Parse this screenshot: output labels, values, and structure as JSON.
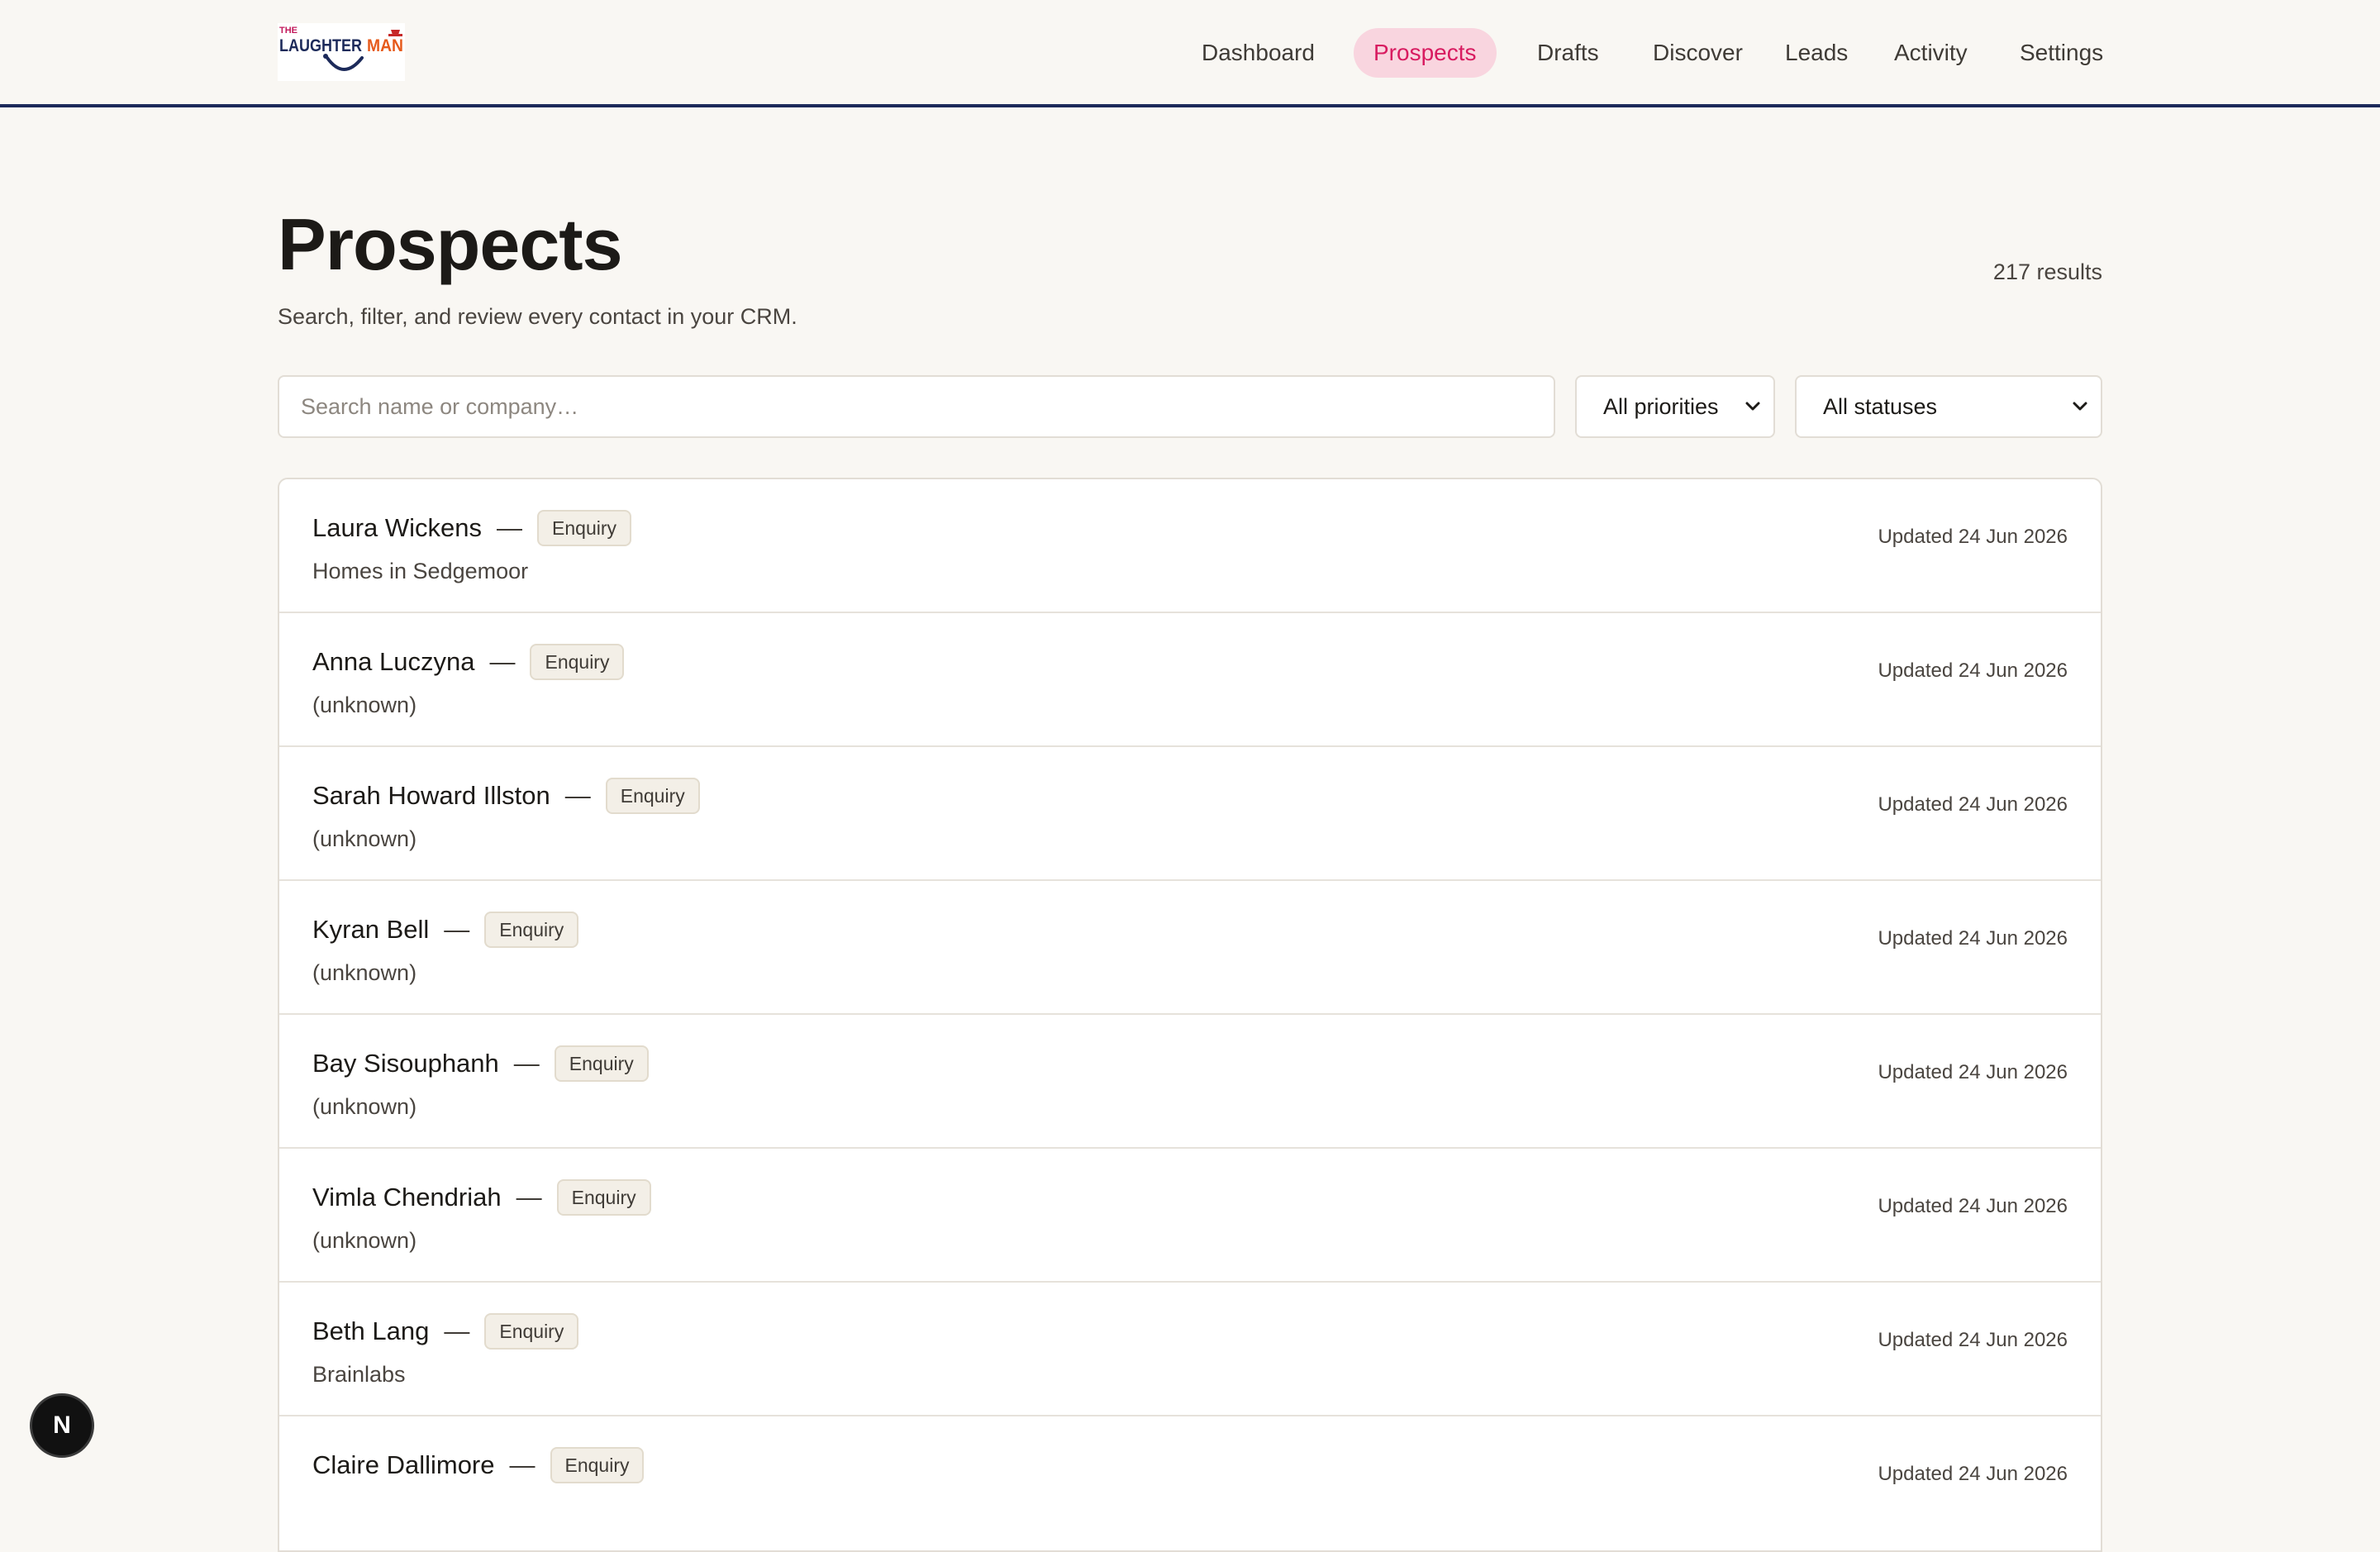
{
  "brand": {
    "logo_top": "THE",
    "logo_main": "LAUGHTER",
    "logo_accent": "MAN"
  },
  "nav": {
    "items": [
      {
        "label": "Dashboard",
        "active": false
      },
      {
        "label": "Prospects",
        "active": true
      },
      {
        "label": "Drafts",
        "active": false
      },
      {
        "label": "Discover",
        "active": false
      },
      {
        "label": "Leads",
        "active": false
      },
      {
        "label": "Activity",
        "active": false
      },
      {
        "label": "Settings",
        "active": false
      }
    ]
  },
  "page": {
    "title": "Prospects",
    "subtitle": "Search, filter, and review every contact in your CRM.",
    "result_count": "217 results"
  },
  "filters": {
    "search_placeholder": "Search name or company…",
    "search_value": "",
    "priority_selected": "All priorities",
    "status_selected": "All statuses"
  },
  "prospects": [
    {
      "name": "Laura Wickens",
      "status": "Enquiry",
      "company": "Homes in Sedgemoor",
      "updated": "Updated 24 Jun 2026"
    },
    {
      "name": "Anna Luczyna",
      "status": "Enquiry",
      "company": "(unknown)",
      "updated": "Updated 24 Jun 2026"
    },
    {
      "name": "Sarah Howard Illston",
      "status": "Enquiry",
      "company": "(unknown)",
      "updated": "Updated 24 Jun 2026"
    },
    {
      "name": "Kyran Bell",
      "status": "Enquiry",
      "company": "(unknown)",
      "updated": "Updated 24 Jun 2026"
    },
    {
      "name": "Bay Sisouphanh",
      "status": "Enquiry",
      "company": "(unknown)",
      "updated": "Updated 24 Jun 2026"
    },
    {
      "name": "Vimla Chendriah",
      "status": "Enquiry",
      "company": "(unknown)",
      "updated": "Updated 24 Jun 2026"
    },
    {
      "name": "Beth Lang",
      "status": "Enquiry",
      "company": "Brainlabs",
      "updated": "Updated 24 Jun 2026"
    },
    {
      "name": "Claire Dallimore",
      "status": "Enquiry",
      "company": "",
      "updated": "Updated 24 Jun 2026"
    }
  ],
  "separator": "—",
  "dev_badge": "N",
  "colors": {
    "accent": "#d81b60",
    "accent_bg": "#f9d5df",
    "header_rule": "#1c2a5a",
    "page_bg": "#f9f7f3"
  },
  "icons": {
    "select_chevron": "chevron-down-icon",
    "dev_badge": "next-js-icon"
  }
}
